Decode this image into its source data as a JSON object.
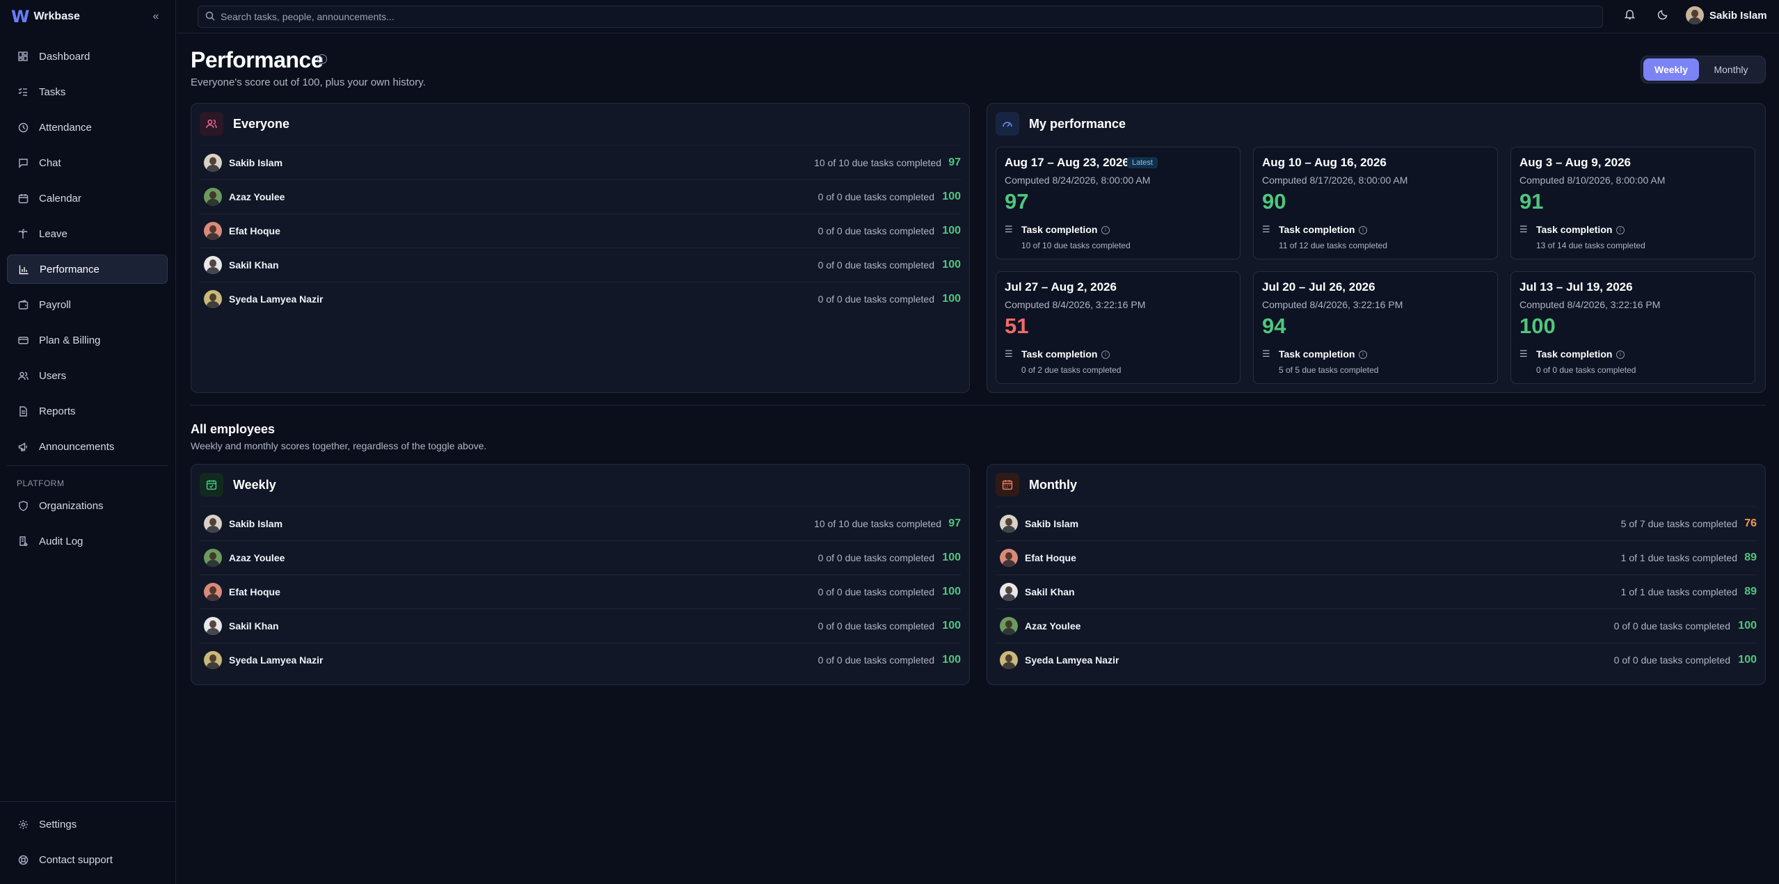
{
  "app": {
    "brand": "Wrkbase",
    "search_placeholder": "Search tasks, people, announcements...",
    "user_name": "Sakib Islam"
  },
  "nav": [
    {
      "label": "Dashboard",
      "icon": "dashboard-icon"
    },
    {
      "label": "Tasks",
      "icon": "tasks-icon"
    },
    {
      "label": "Attendance",
      "icon": "clock-icon"
    },
    {
      "label": "Chat",
      "icon": "chat-icon"
    },
    {
      "label": "Calendar",
      "icon": "calendar-icon"
    },
    {
      "label": "Leave",
      "icon": "palm-tree-icon"
    },
    {
      "label": "Performance",
      "icon": "bar-chart-icon",
      "active": true
    },
    {
      "label": "Payroll",
      "icon": "wallet-icon"
    },
    {
      "label": "Plan & Billing",
      "icon": "credit-card-icon"
    },
    {
      "label": "Users",
      "icon": "users-icon"
    },
    {
      "label": "Reports",
      "icon": "file-icon"
    },
    {
      "label": "Announcements",
      "icon": "megaphone-icon"
    }
  ],
  "platform_label": "PLATFORM",
  "platform_nav": [
    {
      "label": "Organizations",
      "icon": "shield-icon"
    },
    {
      "label": "Audit Log",
      "icon": "log-icon"
    }
  ],
  "bottom_nav": [
    {
      "label": "Settings",
      "icon": "gear-icon"
    },
    {
      "label": "Contact support",
      "icon": "lifebuoy-icon"
    }
  ],
  "page": {
    "title": "Performance",
    "subtitle": "Everyone's score out of 100, plus your own history.",
    "toggle": {
      "weekly": "Weekly",
      "monthly": "Monthly",
      "selected": "Weekly"
    }
  },
  "everyone": {
    "title": "Everyone",
    "rows": [
      {
        "name": "Sakib Islam",
        "detail": "10 of 10 due tasks completed",
        "score": "97"
      },
      {
        "name": "Azaz Youlee",
        "detail": "0 of 0 due tasks completed",
        "score": "100"
      },
      {
        "name": "Efat Hoque",
        "detail": "0 of 0 due tasks completed",
        "score": "100"
      },
      {
        "name": "Sakil Khan",
        "detail": "0 of 0 due tasks completed",
        "score": "100"
      },
      {
        "name": "Syeda Lamyea Nazir",
        "detail": "0 of 0 due tasks completed",
        "score": "100"
      }
    ]
  },
  "my_performance": {
    "title": "My performance",
    "latest_badge": "Latest",
    "metric_label": "Task completion",
    "weeks": [
      {
        "range": "Aug 17 – Aug 23, 2026",
        "computed": "Computed 8/24/2026, 8:00:00 AM",
        "score": "97",
        "detail": "10 of 10 due tasks completed",
        "color": "#4fc77e"
      },
      {
        "range": "Aug 10 – Aug 16, 2026",
        "computed": "Computed 8/17/2026, 8:00:00 AM",
        "score": "90",
        "detail": "11 of 12 due tasks completed",
        "color": "#4fc77e"
      },
      {
        "range": "Aug 3 – Aug 9, 2026",
        "computed": "Computed 8/10/2026, 8:00:00 AM",
        "score": "91",
        "detail": "13 of 14 due tasks completed",
        "color": "#4fc77e"
      },
      {
        "range": "Jul 27 – Aug 2, 2026",
        "computed": "Computed 8/4/2026, 3:22:16 PM",
        "score": "51",
        "detail": "0 of 2 due tasks completed",
        "color": "#ef6b6b"
      },
      {
        "range": "Jul 20 – Jul 26, 2026",
        "computed": "Computed 8/4/2026, 3:22:16 PM",
        "score": "94",
        "detail": "5 of 5 due tasks completed",
        "color": "#4fc77e"
      },
      {
        "range": "Jul 13 – Jul 19, 2026",
        "computed": "Computed 8/4/2026, 3:22:16 PM",
        "score": "100",
        "detail": "0 of 0 due tasks completed",
        "color": "#4fc77e"
      }
    ]
  },
  "all_employees": {
    "title": "All employees",
    "subtitle": "Weekly and monthly scores together, regardless of the toggle above."
  },
  "weekly": {
    "title": "Weekly",
    "rows": [
      {
        "name": "Sakib Islam",
        "detail": "10 of 10 due tasks completed",
        "score": "97"
      },
      {
        "name": "Azaz Youlee",
        "detail": "0 of 0 due tasks completed",
        "score": "100"
      },
      {
        "name": "Efat Hoque",
        "detail": "0 of 0 due tasks completed",
        "score": "100"
      },
      {
        "name": "Sakil Khan",
        "detail": "0 of 0 due tasks completed",
        "score": "100"
      },
      {
        "name": "Syeda Lamyea Nazir",
        "detail": "0 of 0 due tasks completed",
        "score": "100"
      }
    ]
  },
  "monthly": {
    "title": "Monthly",
    "rows": [
      {
        "name": "Sakib Islam",
        "detail": "5 of 7 due tasks completed",
        "score": "76"
      },
      {
        "name": "Efat Hoque",
        "detail": "1 of 1 due tasks completed",
        "score": "89"
      },
      {
        "name": "Sakil Khan",
        "detail": "1 of 1 due tasks completed",
        "score": "89"
      },
      {
        "name": "Azaz Youlee",
        "detail": "0 of 0 due tasks completed",
        "score": "100"
      },
      {
        "name": "Syeda Lamyea Nazir",
        "detail": "0 of 0 due tasks completed",
        "score": "100"
      }
    ]
  },
  "colors": {
    "accent": "#7b83f5",
    "good": "#4fc77e",
    "bad": "#ef6b6b",
    "warn": "#f29a4b"
  }
}
